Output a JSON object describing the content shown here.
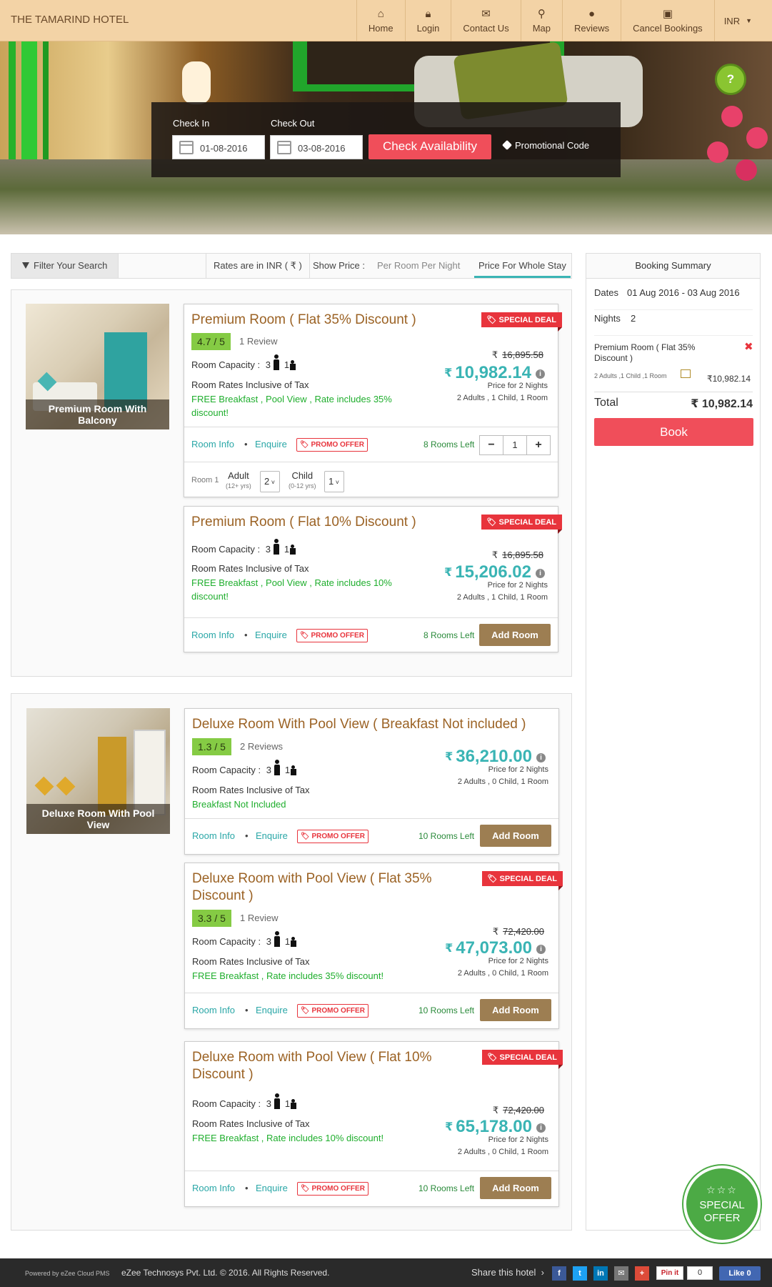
{
  "header": {
    "hotel_name": "THE TAMARIND HOTEL",
    "nav": [
      {
        "label": "Home",
        "icon": "home-icon"
      },
      {
        "label": "Login",
        "icon": "lock-icon"
      },
      {
        "label": "Contact Us",
        "icon": "envelope-icon"
      },
      {
        "label": "Map",
        "icon": "map-marker-icon"
      },
      {
        "label": "Reviews",
        "icon": "comment-icon"
      },
      {
        "label": "Cancel Bookings",
        "icon": "calendar-cancel-icon"
      }
    ],
    "currency": "INR"
  },
  "search": {
    "checkin_label": "Check In",
    "checkin_value": "01-08-2016",
    "checkout_label": "Check Out",
    "checkout_value": "03-08-2016",
    "check_button": "Check Availability",
    "promo_code": "Promotional Code",
    "help": "?"
  },
  "filterbar": {
    "filter_label": "Filter Your Search",
    "rates_in": "Rates are in INR ( ₹ )",
    "show_price": "Show Price :",
    "tab_per_night": "Per Room Per Night",
    "tab_whole_stay": "Price For Whole Stay"
  },
  "common": {
    "room_capacity": "Room Capacity :",
    "inclusive": "Room Rates Inclusive of Tax",
    "room_info": "Room Info",
    "enquire": "Enquire",
    "promo_offer": "PROMO OFFER",
    "special_deal": "SPECIAL DEAL",
    "add_room": "Add Room",
    "price_for": "Price for 2 Nights",
    "rupee": "₹",
    "bullet": "•"
  },
  "groups": [
    {
      "image_caption": "Premium Room With Balcony",
      "rates": [
        {
          "title": "Premium Room ( Flat 35% Discount )",
          "rating": "4.7 / 5",
          "reviews": "1 Review",
          "adults_cap": "3",
          "child_cap": "1",
          "perks": "FREE Breakfast , Pool View , Rate includes 35% discount!",
          "old_price": "16,895.58",
          "price": "10,982.14",
          "pax": "2 Adults , 1 Child, 1 Room",
          "rooms_left": "8 Rooms Left",
          "qty": "1",
          "occupancy": {
            "room": "Room 1",
            "adult": "Adult",
            "adult_age": "(12+ yrs)",
            "adult_val": "2",
            "child": "Child",
            "child_age": "(0-12 yrs)",
            "child_val": "1"
          }
        },
        {
          "title": "Premium Room ( Flat 10% Discount )",
          "adults_cap": "3",
          "child_cap": "1",
          "perks": "FREE Breakfast , Pool View , Rate includes 10% discount!",
          "old_price": "16,895.58",
          "price": "15,206.02",
          "pax": "2 Adults , 1 Child, 1 Room",
          "rooms_left": "8 Rooms Left"
        }
      ]
    },
    {
      "image_caption": "Deluxe Room With Pool View",
      "rates": [
        {
          "title": "Deluxe Room With Pool View ( Breakfast Not included )",
          "rating": "1.3 / 5",
          "reviews": "2 Reviews",
          "adults_cap": "3",
          "child_cap": "1",
          "perks": "Breakfast Not Included",
          "price": "36,210.00",
          "pax": "2 Adults , 0 Child, 1 Room",
          "rooms_left": "10 Rooms Left"
        },
        {
          "title": "Deluxe Room with Pool View ( Flat 35% Discount )",
          "rating": "3.3 / 5",
          "reviews": "1 Review",
          "adults_cap": "3",
          "child_cap": "1",
          "perks": "FREE Breakfast , Rate includes 35% discount!",
          "old_price": "72,420.00",
          "price": "47,073.00",
          "pax": "2 Adults , 0 Child, 1 Room",
          "rooms_left": "10 Rooms Left"
        },
        {
          "title": "Deluxe Room with Pool View ( Flat 10% Discount )",
          "adults_cap": "3",
          "child_cap": "1",
          "perks": "FREE Breakfast , Rate includes 10% discount!",
          "old_price": "72,420.00",
          "price": "65,178.00",
          "pax": "2 Adults , 0 Child, 1 Room",
          "rooms_left": "10 Rooms Left"
        }
      ]
    }
  ],
  "summary": {
    "title": "Booking Summary",
    "dates_label": "Dates",
    "dates_value": "01 Aug 2016 - 03 Aug 2016",
    "nights_label": "Nights",
    "nights_value": "2",
    "room_name": "Premium Room ( Flat 35% Discount )",
    "room_pax": "2 Adults ,1 Child ,1 Room",
    "room_price": "₹10,982.14",
    "total_label": "Total",
    "total_value": "₹ 10,982.14",
    "book": "Book"
  },
  "special_offer": {
    "stars": "☆☆☆",
    "line1": "SPECIAL",
    "line2": "OFFER"
  },
  "footer": {
    "powered": "Powered by eZee Cloud PMS",
    "copyright": "eZee Technosys Pvt. Ltd. © 2016. All Rights Reserved.",
    "share": "Share this hotel",
    "share_icons": [
      {
        "name": "facebook-icon",
        "glyph": "f",
        "color": "#3b5998"
      },
      {
        "name": "twitter-icon",
        "glyph": "t",
        "color": "#1da1f2"
      },
      {
        "name": "linkedin-icon",
        "glyph": "in",
        "color": "#0077b5"
      },
      {
        "name": "email-icon",
        "glyph": "✉",
        "color": "#777777"
      },
      {
        "name": "google-plus-icon",
        "glyph": "+",
        "color": "#dd4b39"
      }
    ],
    "pin": "Pin it",
    "pin_count": "0",
    "fb_like": "Like 0"
  }
}
